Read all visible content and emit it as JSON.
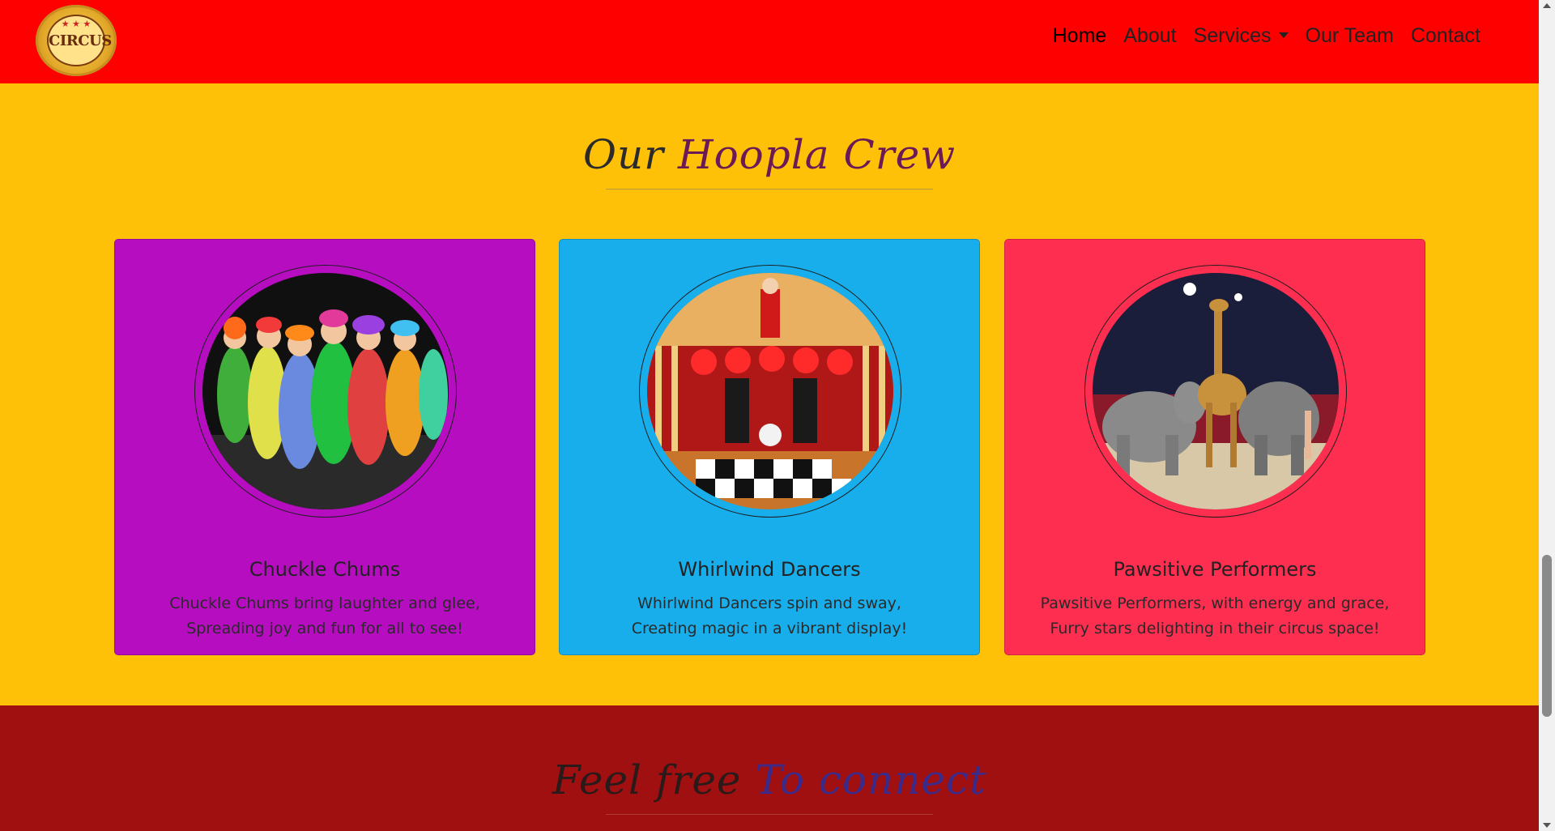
{
  "navbar": {
    "logo_text": "CIRCUS",
    "links": [
      {
        "label": "Home"
      },
      {
        "label": "About"
      },
      {
        "label": "Services"
      },
      {
        "label": "Our Team"
      },
      {
        "label": "Contact"
      }
    ]
  },
  "team": {
    "title_part1": "Our",
    "title_part2": "Hoopla Crew",
    "cards": [
      {
        "name": "Chuckle Chums",
        "line1": "Chuckle Chums bring laughter and glee,",
        "line2": "Spreading joy and fun for all to see!",
        "color": "#b60dc0"
      },
      {
        "name": "Whirlwind Dancers",
        "line1": "Whirlwind Dancers spin and sway,",
        "line2": "Creating magic in a vibrant display!",
        "color": "#17aeeb"
      },
      {
        "name": "Pawsitive Performers",
        "line1": "Pawsitive Performers, with energy and grace,",
        "line2": "Furry stars delighting in their circus space!",
        "color": "#fe2e50"
      }
    ]
  },
  "contact": {
    "title_part1": "Feel free",
    "title_part2": "To connect"
  },
  "colors": {
    "navbar_bg": "#ff0000",
    "page_bg": "#fec108",
    "contact_bg": "#a11010"
  }
}
